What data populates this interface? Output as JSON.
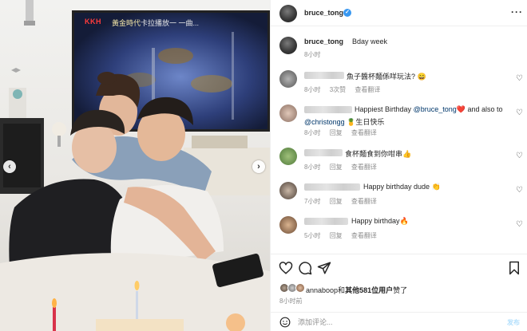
{
  "photo": {
    "tv_brand": "KKH",
    "tv_title": "黃金時代",
    "tv_caption": "卡拉播放一  一曲..."
  },
  "header": {
    "username": "bruce_tong",
    "verified_icon": "verified-badge-icon",
    "more_icon": "more-options-icon",
    "more_glyph": "···"
  },
  "caption": {
    "username": "bruce_tong",
    "text": "Bday week",
    "time": "8小时"
  },
  "comments": [
    {
      "text": "魚子醬杯麵係咩玩法? 😄",
      "time": "8小时",
      "likes": "3次赞",
      "action": "查看翻译"
    },
    {
      "text": "Happiest Birthday",
      "mention1": "@bruce_tong",
      "text_after": "❤️ and also to",
      "mention2": "@christongg",
      "line2": "🍍生日快乐",
      "time": "8小时",
      "reply": "回复",
      "action": "查看翻译"
    },
    {
      "text": "食杯麵食到你咁串👍",
      "time": "8小时",
      "reply": "回复",
      "action": "查看翻译"
    },
    {
      "text": "Happy birthday dude 👏",
      "time": "7小时",
      "reply": "回复",
      "action": "查看翻译"
    },
    {
      "text": "Happy birthday🔥",
      "time": "5小时",
      "reply": "回复",
      "action": "查看翻译"
    }
  ],
  "likes": {
    "user": "annaboop",
    "middle": "和",
    "others": "其他581位用户",
    "suffix": "赞了"
  },
  "post_time": "8小时前",
  "comment_input": {
    "placeholder": "添加评论...",
    "post_label": "发布"
  },
  "icons": [
    "heart-icon",
    "comment-icon",
    "share-icon",
    "bookmark-icon",
    "emoji-icon",
    "chevron-left-icon",
    "chevron-right-icon"
  ]
}
